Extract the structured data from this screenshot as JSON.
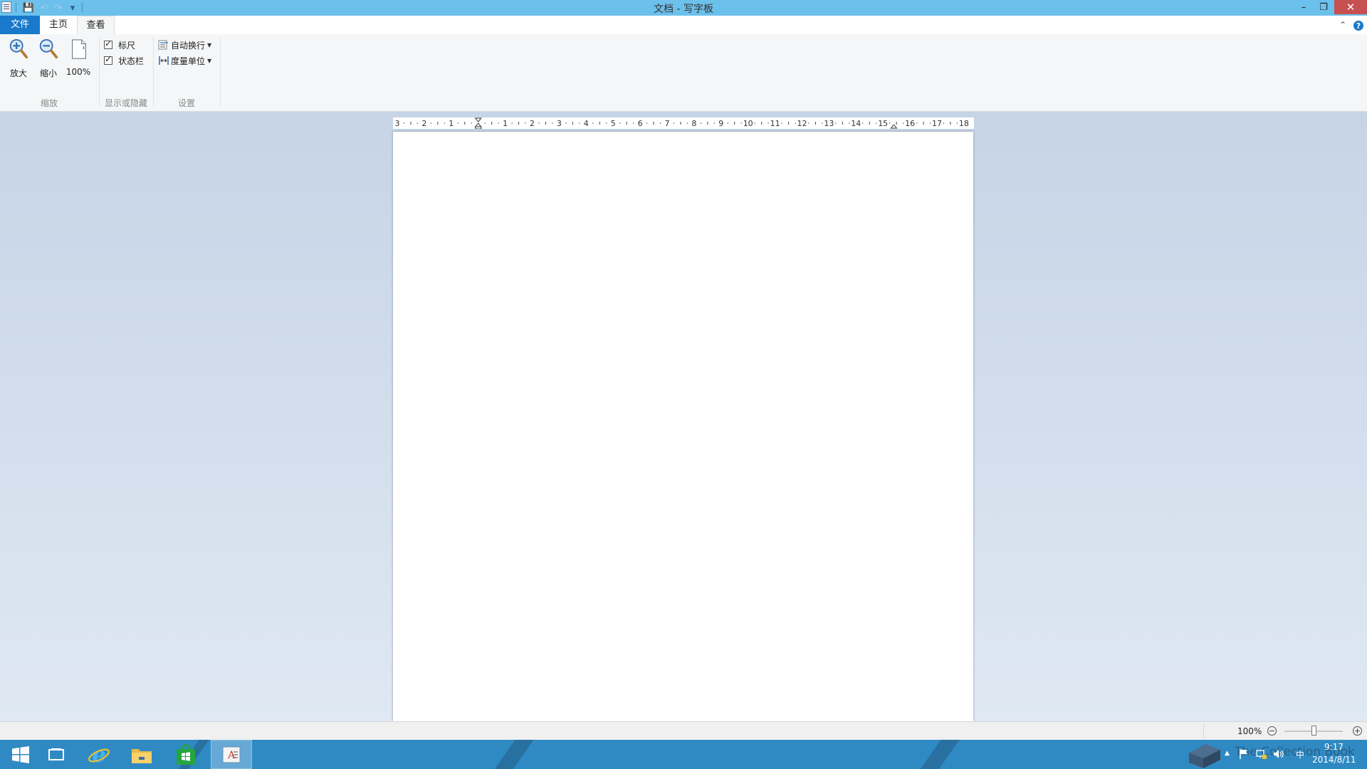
{
  "window": {
    "title": "文档 - 写字板",
    "min_glyph": "–",
    "restore_glyph": "❐",
    "close_glyph": "✕"
  },
  "qat": {
    "save_glyph": "💾",
    "undo_glyph": "↶",
    "redo_glyph": "↷",
    "customize_glyph": "▾"
  },
  "tabs": [
    {
      "label": "文件"
    },
    {
      "label": "主页"
    },
    {
      "label": "查看"
    }
  ],
  "ribbon_controls": {
    "minimize_glyph": "⌃",
    "help_glyph": "?"
  },
  "ribbon": {
    "zoom_group": {
      "label": "缩放",
      "zoom_in": "放大",
      "zoom_out": "缩小",
      "hundred": "100%"
    },
    "show_hide_group": {
      "label": "显示或隐藏",
      "ruler": "标尺",
      "ruler_checked": true,
      "statusbar": "状态栏",
      "statusbar_checked": true
    },
    "settings_group": {
      "label": "设置",
      "word_wrap": "自动换行",
      "measure_units": "度量单位"
    }
  },
  "ruler": {
    "labels": [
      "3",
      "2",
      "1",
      "",
      "1",
      "2",
      "3",
      "4",
      "5",
      "6",
      "7",
      "8",
      "9",
      "10",
      "11",
      "12",
      "13",
      "14",
      "15",
      "16",
      "17",
      "18"
    ]
  },
  "status": {
    "zoom": "100%",
    "zoom_fraction": 0.5,
    "minus_glyph": "−",
    "plus_glyph": "+"
  },
  "taskbar": {
    "tray_expand": "▲",
    "ime": "中",
    "time": "9:17",
    "date": "2014/8/11",
    "watermark": "The Collection Book"
  },
  "colors": {
    "titlebar": "#6cc0ec",
    "file_tab": "#1979ca",
    "taskbar": "#2f8ac4",
    "close": "#c75050"
  }
}
